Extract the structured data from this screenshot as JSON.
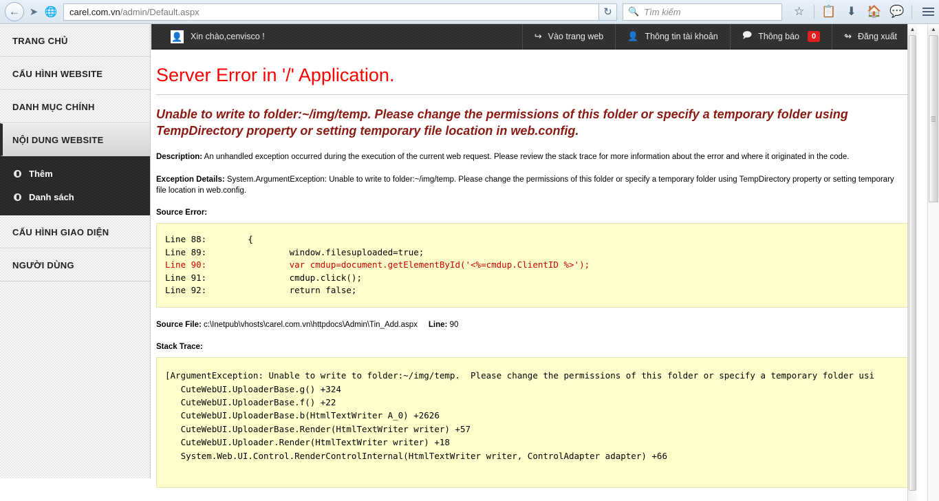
{
  "browser": {
    "back_icon": "back-arrow-icon",
    "forward_icon": "forward-arrow-icon",
    "globe_icon": "globe-icon",
    "url_host": "carel.com.vn",
    "url_path": "/admin/Default.aspx",
    "reload_icon": "reload-icon",
    "search_placeholder": "Tìm kiếm",
    "search_icon": "search-icon",
    "toolbar_icons": [
      "bookmark-star-icon",
      "reader-list-icon",
      "downloads-icon",
      "home-icon",
      "sync-chat-icon"
    ],
    "menu_icon": "hamburger-menu-icon"
  },
  "sidebar": {
    "items": [
      {
        "label": "TRANG CHỦ",
        "active": false
      },
      {
        "label": "CẤU HÌNH WEBSITE",
        "active": false
      },
      {
        "label": "DANH MỤC CHÍNH",
        "active": false
      },
      {
        "label": "NỘI DUNG WEBSITE",
        "active": true
      },
      {
        "label": "CẤU HÌNH GIAO DIỆN",
        "active": false
      },
      {
        "label": "NGƯỜI DÙNG",
        "active": false
      }
    ],
    "submenu": [
      {
        "label": "Thêm"
      },
      {
        "label": "Danh sách"
      }
    ]
  },
  "topbar": {
    "avatar_icon": "user-avatar-icon",
    "greeting": "Xin chào,cenvisco !",
    "actions": [
      {
        "label": "Vào trang web",
        "icon": "back-curve-icon",
        "badge": null
      },
      {
        "label": "Thông tin tài khoản",
        "icon": "user-icon",
        "badge": null
      },
      {
        "label": "Thông báo",
        "icon": "chat-bubble-icon",
        "badge": "0"
      },
      {
        "label": "Đăng xuất",
        "icon": "logout-arrow-icon",
        "badge": null
      }
    ],
    "badge_color": "#e02020"
  },
  "error": {
    "title": "Server Error in '/' Application.",
    "message": "Unable to write to folder:~/img/temp.  Please change the permissions of this folder or specify a temporary folder using TempDirectory property or setting temporary file location in web.config.",
    "description_label": "Description:",
    "description_text": "An unhandled exception occurred during the execution of the current web request. Please review the stack trace for more information about the error and where it originated in the code.",
    "exception_label": "Exception Details:",
    "exception_text": "System.ArgumentException: Unable to write to folder:~/img/temp.  Please change the permissions of this folder or specify a temporary folder using TempDirectory property or setting temporary file location in web.config.",
    "source_error_label": "Source Error:",
    "source_lines": [
      {
        "num": "Line 88:",
        "code": "        {",
        "highlight": false
      },
      {
        "num": "Line 89:",
        "code": "                window.filesuploaded=true;",
        "highlight": false
      },
      {
        "num": "Line 90:",
        "code": "                var cmdup=document.getElementById('<%=cmdup.ClientID %>');",
        "highlight": true
      },
      {
        "num": "Line 91:",
        "code": "                cmdup.click();",
        "highlight": false
      },
      {
        "num": "Line 92:",
        "code": "                return false;",
        "highlight": false
      }
    ],
    "source_file_label": "Source File:",
    "source_file_value": "c:\\Inetpub\\vhosts\\carel.com.vn\\httpdocs\\Admin\\Tin_Add.aspx",
    "line_label": "Line:",
    "line_value": "90",
    "stack_trace_label": "Stack Trace:",
    "stack_trace_lines": [
      "[ArgumentException: Unable to write to folder:~/img/temp.  Please change the permissions of this folder or specify a temporary folder usi",
      "   CuteWebUI.UploaderBase.g() +324",
      "   CuteWebUI.UploaderBase.f() +22",
      "   CuteWebUI.UploaderBase.b(HtmlTextWriter A_0) +2626",
      "   CuteWebUI.UploaderBase.Render(HtmlTextWriter writer) +57",
      "   CuteWebUI.Uploader.Render(HtmlTextWriter writer) +18",
      "   System.Web.UI.Control.RenderControlInternal(HtmlTextWriter writer, ControlAdapter adapter) +66"
    ]
  },
  "scrollbars": {
    "up_arrow": "▲",
    "down_arrow": "▼"
  }
}
